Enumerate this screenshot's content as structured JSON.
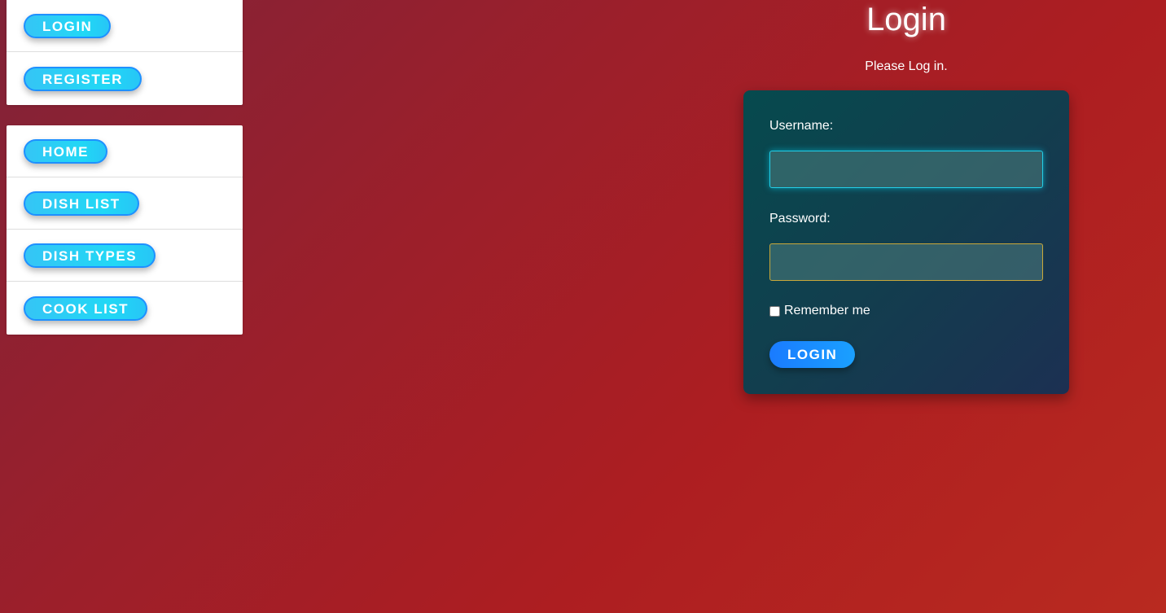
{
  "sidebar": {
    "auth_items": [
      {
        "label": "LOGIN"
      },
      {
        "label": "REGISTER"
      }
    ],
    "main_items": [
      {
        "label": "HOME"
      },
      {
        "label": "DISH LIST"
      },
      {
        "label": "DISH TYPES"
      },
      {
        "label": "COOK LIST"
      }
    ]
  },
  "login": {
    "title": "Login",
    "subtitle": "Please Log in.",
    "username_label": "Username:",
    "username_value": "",
    "password_label": "Password:",
    "password_value": "",
    "remember_label": "Remember me",
    "remember_checked": false,
    "submit_label": "LOGIN"
  },
  "colors": {
    "background_start": "#812338",
    "background_end": "#b92a20",
    "nav_button": "#21d8f5",
    "nav_button_border": "#1e90ff",
    "card_start": "#064a4e",
    "card_end": "#1c3052",
    "submit_button": "#1a7bff"
  }
}
